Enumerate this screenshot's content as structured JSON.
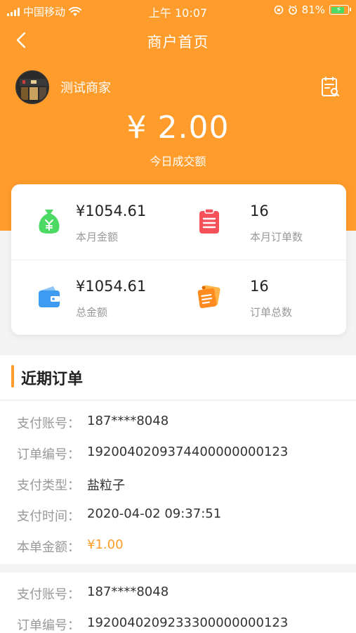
{
  "status_bar": {
    "carrier": "中国移动",
    "time": "上午 10:07",
    "battery_pct": "81%"
  },
  "nav": {
    "title": "商户首页"
  },
  "merchant": {
    "name": "测试商家"
  },
  "today": {
    "amount": "¥ 2.00",
    "label": "今日成交额"
  },
  "stats": [
    {
      "value": "¥1054.61",
      "label": "本月金额",
      "icon": "money-bag-icon"
    },
    {
      "value": "16",
      "label": "本月订单数",
      "icon": "clipboard-icon"
    },
    {
      "value": "¥1054.61",
      "label": "总金额",
      "icon": "wallet-icon"
    },
    {
      "value": "16",
      "label": "订单总数",
      "icon": "order-notes-icon"
    }
  ],
  "recent_orders": {
    "title": "近期订单",
    "orders": [
      {
        "account_label": "支付账号：",
        "account": "187****8048",
        "order_no_label": "订单编号：",
        "order_no": "1920040209374400000000123",
        "pay_type_label": "支付类型：",
        "pay_type": "盐粒子",
        "pay_time_label": "支付时间：",
        "pay_time": "2020-04-02 09:37:51",
        "amount_label": "本单金额：",
        "amount": "¥1.00"
      },
      {
        "account_label": "支付账号：",
        "account": "187****8048",
        "order_no_label": "订单编号：",
        "order_no": "1920040209233300000000123"
      }
    ]
  },
  "colors": {
    "accent": "#FF9C2B",
    "green": "#4CD964",
    "red": "#F4515A",
    "blue": "#3E9BF2"
  }
}
